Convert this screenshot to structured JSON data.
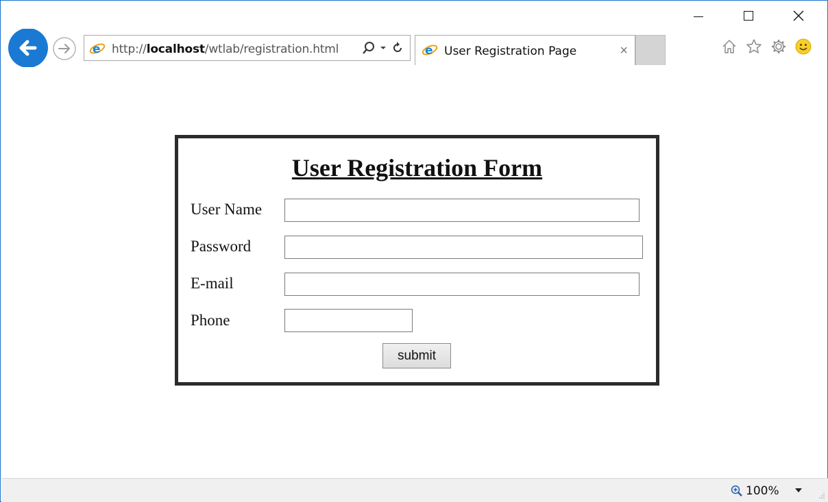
{
  "browser": {
    "address": {
      "scheme": "http://",
      "host": "localhost",
      "path": "/wtlab/registration.html"
    },
    "tab": {
      "title": "User Registration Page",
      "close_glyph": "×"
    },
    "toolbar_icons": [
      "home-icon",
      "star-icon",
      "gear-icon",
      "smiley-icon"
    ]
  },
  "form": {
    "title": "User Registration Form",
    "fields": [
      {
        "label": "User Name",
        "value": ""
      },
      {
        "label": "Password",
        "value": ""
      },
      {
        "label": "E-mail",
        "value": ""
      },
      {
        "label": "Phone",
        "value": ""
      }
    ],
    "submit_label": "submit"
  },
  "status": {
    "zoom": "100%"
  },
  "colors": {
    "accent": "#1a73c9",
    "form_border": "#2b2b2b"
  }
}
